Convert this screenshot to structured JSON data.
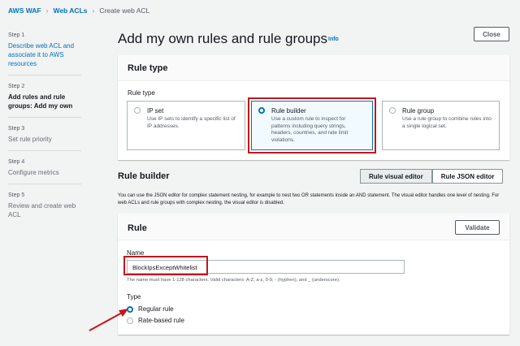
{
  "breadcrumb": [
    "AWS WAF",
    "Web ACLs",
    "Create web ACL"
  ],
  "steps": [
    {
      "num": "Step 1",
      "label": "Describe web ACL and associate it to AWS resources"
    },
    {
      "num": "Step 2",
      "label": "Add rules and rule groups: Add my own"
    },
    {
      "num": "Step 3",
      "label": "Set rule priority"
    },
    {
      "num": "Step 4",
      "label": "Configure metrics"
    },
    {
      "num": "Step 5",
      "label": "Review and create web ACL"
    }
  ],
  "title": "Add my own rules and rule groups",
  "info": "Info",
  "close": "Close",
  "rule_type": {
    "heading": "Rule type",
    "label": "Rule type",
    "options": [
      {
        "title": "IP set",
        "desc": "Use IP sets to identify a specific list of IP addresses."
      },
      {
        "title": "Rule builder",
        "desc": "Use a custom rule to inspect for patterns including query strings, headers, countries, and rate limit violations."
      },
      {
        "title": "Rule group",
        "desc": "Use a rule group to combine rules into a single logical set."
      }
    ]
  },
  "rule_builder": {
    "heading": "Rule builder",
    "visual": "Rule visual editor",
    "json": "Rule JSON editor",
    "desc": "You can use the JSON editor for complex statement nesting, for example to nest two OR statements inside an AND statement. The visual editor handles one level of nesting. For web ACLs and rule groups with complex nesting, the visual editor is disabled."
  },
  "rule": {
    "heading": "Rule",
    "validate": "Validate",
    "name_label": "Name",
    "name_value": "BlockIpsExceptWhitelist",
    "hint": "The name must have 1-128 characters. Valid characters: A-Z, a-z, 0-9, - (hyphen), and _ (underscore).",
    "type_label": "Type",
    "types": [
      "Regular rule",
      "Rate-based rule"
    ]
  },
  "colors": {
    "accent": "#0073bb",
    "highlight": "#c4161c"
  }
}
